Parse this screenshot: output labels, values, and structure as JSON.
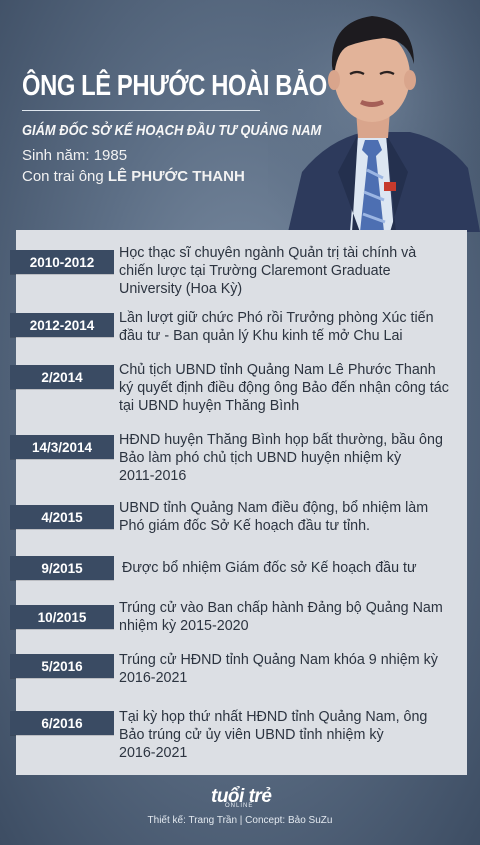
{
  "header": {
    "title": "ÔNG LÊ PHƯỚC HOÀI BẢO",
    "position": "GIÁM ĐỐC SỞ KẾ HOẠCH ĐẦU TƯ QUẢNG NAM",
    "birth": "Sinh năm: 1985",
    "father_prefix": "Con trai ông ",
    "father_name": "LÊ PHƯỚC THANH"
  },
  "timeline": [
    {
      "date": "2010-2012",
      "lines": [
        "Học thạc sĩ chuyên ngành Quản trị tài chính và",
        "chiến lược tại Trường Claremont Graduate",
        "University (Hoa Kỳ)"
      ]
    },
    {
      "date": "2012-2014",
      "lines": [
        "Lần lượt giữ chức Phó rồi Trưởng phòng Xúc tiến",
        "đầu tư - Ban quản lý Khu kinh tế mở Chu Lai"
      ]
    },
    {
      "date": "2/2014",
      "lines": [
        "Chủ tịch UBND tỉnh Quảng Nam Lê Phước Thanh",
        "ký quyết định điều động ông Bảo đến nhận công tác",
        "tại UBND huyện Thăng Bình"
      ]
    },
    {
      "date": "14/3/2014",
      "lines": [
        "HĐND huyện Thăng Bình họp bất thường, bầu ông",
        "Bảo làm phó chủ tịch UBND huyện nhiệm kỳ",
        "2011-2016"
      ]
    },
    {
      "date": "4/2015",
      "lines": [
        "UBND tỉnh Quảng Nam điều động, bổ nhiệm làm",
        "Phó giám đốc Sở Kế hoạch đầu tư tỉnh."
      ]
    },
    {
      "date": "9/2015",
      "lines": [
        "Được bổ nhiệm Giám đốc sở Kế hoạch đầu tư"
      ]
    },
    {
      "date": "10/2015",
      "lines": [
        "Trúng cử vào Ban chấp hành Đảng bộ Quảng Nam",
        "nhiệm kỳ 2015-2020"
      ]
    },
    {
      "date": "5/2016",
      "lines": [
        "Trúng cử HĐND tỉnh Quảng Nam khóa 9 nhiệm kỳ",
        "2016-2021"
      ]
    },
    {
      "date": "6/2016",
      "lines": [
        "Tại kỳ họp thứ nhất HĐND tỉnh Quảng Nam, ông",
        "Bảo trúng cử ủy viên UBND tỉnh nhiệm kỳ",
        "2016-2021"
      ]
    }
  ],
  "footer": {
    "logo": "tuổi trẻ",
    "logo_sub": "ONLINE",
    "credit": "Thiết kế: Trang Trần | Concept: Bảo SuZu"
  },
  "colors": {
    "date_tag": "#3a4b63",
    "panel": "#dcdfe4",
    "background": "#5d6f86"
  }
}
